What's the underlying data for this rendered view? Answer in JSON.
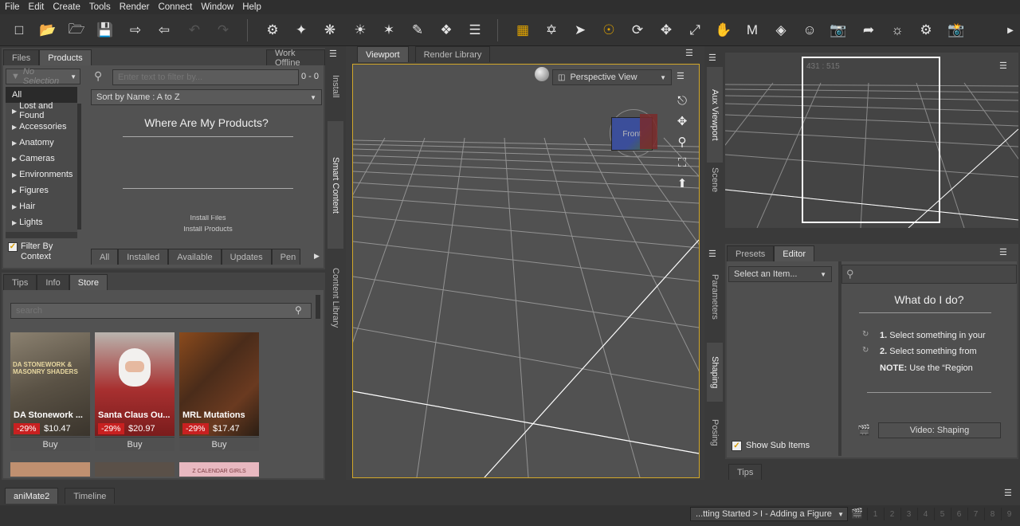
{
  "menu": [
    "File",
    "Edit",
    "Create",
    "Tools",
    "Render",
    "Connect",
    "Window",
    "Help"
  ],
  "toolbar": {
    "icons": [
      "new-file-icon",
      "open-file-icon",
      "merge-file-icon",
      "save-icon",
      "import-icon",
      "export-icon",
      "undo-icon",
      "redo-icon",
      "add-figure-icon",
      "spotlight-icon",
      "distant-light-icon",
      "point-light-icon",
      "spot-light-icon",
      "camera-icon",
      "align-icon",
      "shader-icon",
      "orbit-icon",
      "node-select-icon",
      "rotate-icon",
      "translate-icon",
      "scale-icon",
      "joint-editor-icon",
      "morph-icon",
      "geometry-editor-icon",
      "figure-setup-icon",
      "render-icon",
      "surface-selection-icon",
      "render-settings-icon",
      "spot-render-icon",
      "render-camera-icon"
    ]
  },
  "left_top": {
    "tabs": [
      "Files",
      "Products"
    ],
    "work_offline": "Work Offline",
    "filter_dropdown": "No Selection",
    "search_placeholder": "Enter text to filter by...",
    "count": "0 - 0",
    "sort": "Sort by Name : A to Z",
    "categories": [
      "All",
      "Lost and Found",
      "Accessories",
      "Anatomy",
      "Cameras",
      "Environments",
      "Figures",
      "Hair",
      "Lights"
    ],
    "filter_by_context": "Filter By Context",
    "where_title": "Where Are My Products?",
    "link1": "Install Files",
    "link2": "Install Products",
    "filter_tabs": [
      "All",
      "Installed",
      "Available",
      "Updates",
      "Pen"
    ]
  },
  "side_tabs_left": [
    "Install",
    "Smart Content",
    "Content Library"
  ],
  "left_bottom": {
    "tabs": [
      "Tips",
      "Info",
      "Store"
    ],
    "search_placeholder": "search",
    "products": [
      {
        "name": "DA Stonework ...",
        "discount": "-29%",
        "price": "$10.47",
        "thumb_text": "DA STONEWORK & MASONRY SHADERS",
        "buy": "Buy",
        "color": "#6b6250"
      },
      {
        "name": "Santa Claus Ou...",
        "discount": "-29%",
        "price": "$20.97",
        "thumb_text": "",
        "buy": "Buy",
        "color": "#a23030"
      },
      {
        "name": "MRL Mutations",
        "discount": "-29%",
        "price": "$17.47",
        "thumb_text": "",
        "buy": "Buy",
        "color": "#5a3a20"
      }
    ],
    "next_thumb_text": "Z CALENDAR GIRLS"
  },
  "viewport": {
    "tabs": [
      "Viewport",
      "Render Library"
    ],
    "view_selector": "Perspective View",
    "cube_label": "Front"
  },
  "aux": {
    "side_tabs": [
      "Aux Viewport",
      "Scene"
    ],
    "coords": "431 : 515"
  },
  "right_bottom": {
    "side_tabs": [
      "Parameters",
      "Shaping",
      "Posing"
    ],
    "tabs": [
      "Presets",
      "Editor"
    ],
    "select_item": "Select an Item...",
    "what_title": "What do I do?",
    "steps": [
      {
        "num": "1.",
        "text": "Select something in your"
      },
      {
        "num": "2.",
        "text": "Select something from"
      }
    ],
    "note_label": "NOTE:",
    "note_text": "Use the “Region",
    "show_sub_items": "Show Sub Items",
    "video_btn": "Video: Shaping",
    "tips_tab": "Tips"
  },
  "bottom": {
    "tabs": [
      "aniMate2",
      "Timeline"
    ],
    "lesson": "...tting Started > I - Adding a Figure",
    "pages": [
      "1",
      "2",
      "3",
      "4",
      "5",
      "6",
      "7",
      "8",
      "9"
    ]
  }
}
